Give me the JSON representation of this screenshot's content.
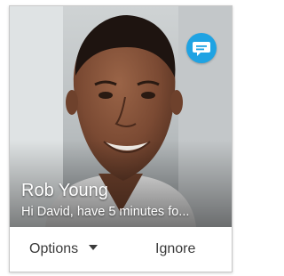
{
  "caller": {
    "name": "Rob Young",
    "message_preview": "Hi David, have 5 minutes fo...",
    "photo_icon": "caller-photo"
  },
  "badge": {
    "icon": "chat-bubble-icon",
    "color": "#1fa3e3"
  },
  "actions": {
    "options_label": "Options",
    "ignore_label": "Ignore"
  }
}
